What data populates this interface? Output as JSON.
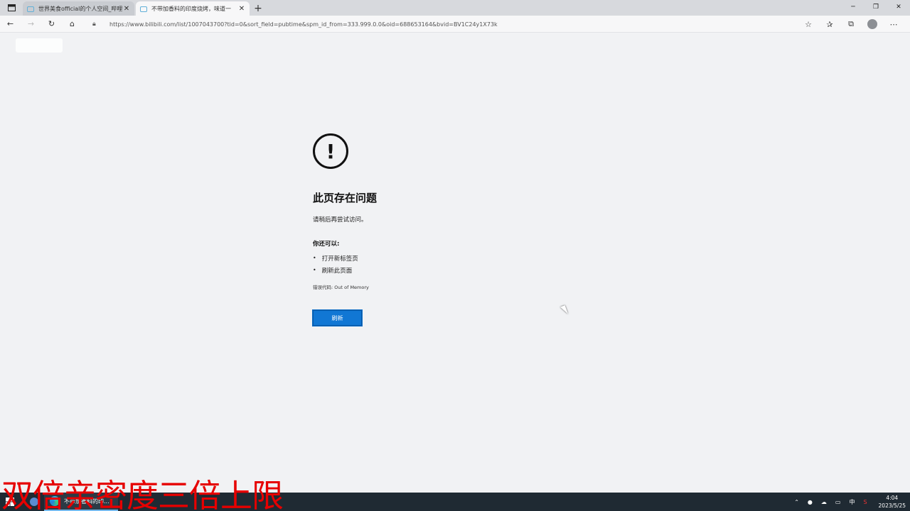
{
  "tabs": [
    {
      "title": "世界美食official的个人空间_哔哩",
      "active": false
    },
    {
      "title": "不带加香料的印度烧烤，味道一",
      "active": true
    }
  ],
  "address": {
    "url": "https://www.bilibili.com/list/1007043700?tid=0&sort_field=pubtime&spm_id_from=333.999.0.0&oid=688653164&bvid=BV1C24y1X73k"
  },
  "error": {
    "title": "此页存在问题",
    "subtitle": "请稍后再尝试访问。",
    "also_label": "你还可以:",
    "options": [
      "打开新标签页",
      "刷新此页面"
    ],
    "code": "错误代码: Out of Memory",
    "refresh_label": "刷新"
  },
  "overlay": {
    "caption": "双倍亲密度三倍上限"
  },
  "taskbar": {
    "app_label": "不带加香料的印...",
    "ime": "中",
    "time": "4:04",
    "date": "2023/5/25"
  },
  "colors": {
    "accent": "#1177d4",
    "overlay_red": "#e60000",
    "taskbar": "#1f2a33"
  }
}
